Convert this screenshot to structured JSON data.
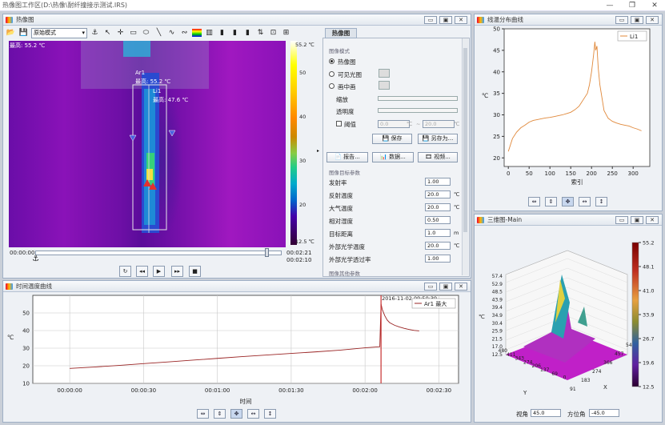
{
  "app": {
    "title": "热像图工作区(D:\\热像\\耐纤撞接示测试.IRS)"
  },
  "thermal": {
    "title": "热像图",
    "mode": "原始模式",
    "max_label": "最高: 55.2 ℃",
    "ar1_name": "Ar1",
    "ar1_max": "最高: 55.2 ℃",
    "li1_name": "Li1",
    "li1_max": "最高: 47.6 ℃",
    "legend_ticks": [
      "55.2 ℃",
      "50",
      "40",
      "30",
      "20",
      "12.5 ℃"
    ],
    "time_start": "00:00:00",
    "time_end": "00:02:21",
    "time_current": "00:02:10",
    "controls": [
      "↻",
      "◂◂",
      "▶",
      "▸▸",
      "■"
    ]
  },
  "props": {
    "tab": "热像图",
    "image_mode_title": "图像模式",
    "radio_thermal": "热像图",
    "radio_visible": "可见光图",
    "radio_pip": "画中画",
    "zoom": "缩放",
    "transparency": "透明度",
    "threshold": "阈值",
    "thr_low": "0.0",
    "thr_high": "20.0",
    "unit_c": "℃",
    "tilde": "~",
    "save": "保存",
    "save_as": "另存为...",
    "report": "报告...",
    "data": "数据...",
    "video": "视频...",
    "target_title": "图像目标参数",
    "params": [
      {
        "label": "发射率",
        "value": "1.00",
        "unit": ""
      },
      {
        "label": "反射温度",
        "value": "20.0",
        "unit": "℃"
      },
      {
        "label": "大气温度",
        "value": "20.0",
        "unit": "℃"
      },
      {
        "label": "相对湿度",
        "value": "0.50",
        "unit": ""
      },
      {
        "label": "目标距离",
        "value": "1.0",
        "unit": "m"
      },
      {
        "label": "外部光学温度",
        "value": "20.0",
        "unit": "℃"
      },
      {
        "label": "外部光学透过率",
        "value": "1.00",
        "unit": ""
      }
    ],
    "other_title": "图像其他参数"
  },
  "line_plot": {
    "title": "线温分布曲线",
    "legend": "Li1",
    "ylabel": "℃",
    "xlabel": "索引"
  },
  "time_plot": {
    "title": "时间温度曲线",
    "legend": "Ar1 最大",
    "ylabel": "℃",
    "xlabel": "时间",
    "marker": "2016-11-02 09:50:39"
  },
  "surface": {
    "title": "三维图-Main",
    "z_label": "℃",
    "x_label": "X",
    "y_label": "Y",
    "view_label": "视角",
    "view_value": "45.0",
    "azimuth_label": "方位角",
    "azimuth_value": "-45.0"
  },
  "colors": {
    "curve": "#e0883a",
    "time_curve": "#9a2424",
    "marker": "#c83030"
  },
  "chart_data": [
    {
      "type": "line",
      "name": "line_profile",
      "series": [
        {
          "name": "Li1",
          "x": [
            0,
            10,
            20,
            30,
            40,
            50,
            60,
            70,
            80,
            90,
            100,
            110,
            120,
            130,
            140,
            150,
            160,
            170,
            180,
            190,
            195,
            200,
            205,
            208,
            210,
            213,
            216,
            220,
            225,
            230,
            240,
            250,
            260,
            270,
            280,
            290,
            300,
            310,
            320
          ],
          "y": [
            21.5,
            24.5,
            26,
            27,
            27.6,
            28.3,
            28.7,
            28.9,
            29.1,
            29.3,
            29.4,
            29.6,
            29.8,
            30.0,
            30.3,
            30.6,
            31.2,
            32,
            33.5,
            35,
            37,
            40,
            44,
            47,
            45,
            46,
            41,
            37,
            34,
            31,
            29.2,
            28.5,
            28.1,
            27.8,
            27.6,
            27.4,
            27,
            26.7,
            26.3
          ]
        }
      ],
      "xticks": [
        "0",
        "50",
        "100",
        "150",
        "200",
        "250",
        "300"
      ],
      "yticks": [
        "20",
        "25",
        "30",
        "35",
        "40",
        "45",
        "50"
      ],
      "xlim": [
        -10,
        340
      ],
      "ylim": [
        18,
        50
      ],
      "xlabel": "索引",
      "ylabel": "℃"
    },
    {
      "type": "line",
      "name": "time_curve",
      "series": [
        {
          "name": "Ar1 最大",
          "x": [
            0,
            10,
            20,
            30,
            40,
            50,
            60,
            70,
            80,
            90,
            100,
            110,
            120,
            126,
            126.5,
            127,
            128,
            129,
            130,
            132,
            134,
            136,
            138,
            140,
            142
          ],
          "y": [
            18.5,
            19.3,
            20.2,
            21.2,
            22.2,
            23.2,
            24.2,
            25.2,
            26.1,
            27,
            27.9,
            28.9,
            30.2,
            30.8,
            55.2,
            52,
            48.5,
            46,
            44.5,
            43,
            42,
            41.2,
            40.6,
            40.1,
            39.8
          ]
        }
      ],
      "xticks": [
        "00:00:00",
        "00:00:30",
        "00:01:00",
        "00:01:30",
        "00:02:00",
        "00:02:30"
      ],
      "yticks": [
        "10",
        "20",
        "30",
        "40",
        "50"
      ],
      "xlim": [
        -15,
        158
      ],
      "ylim": [
        10,
        60
      ],
      "xlabel": "时间",
      "ylabel": "℃"
    },
    {
      "type": "surface",
      "name": "3d_surface",
      "z_ticks": [
        "57.4",
        "52.9",
        "48.5",
        "43.9",
        "39.4",
        "34.9",
        "30.4",
        "25.9",
        "21.5",
        "17.0",
        "12.5"
      ],
      "x_ticks": [
        "91",
        "183",
        "274",
        "366",
        "457",
        "549"
      ],
      "y_ticks": [
        "480",
        "411",
        "343",
        "274",
        "206",
        "137",
        "69",
        "0"
      ],
      "colorbar_ticks": [
        "55.2",
        "48.1",
        "41.0",
        "33.9",
        "26.7",
        "19.6",
        "12.5"
      ]
    }
  ]
}
